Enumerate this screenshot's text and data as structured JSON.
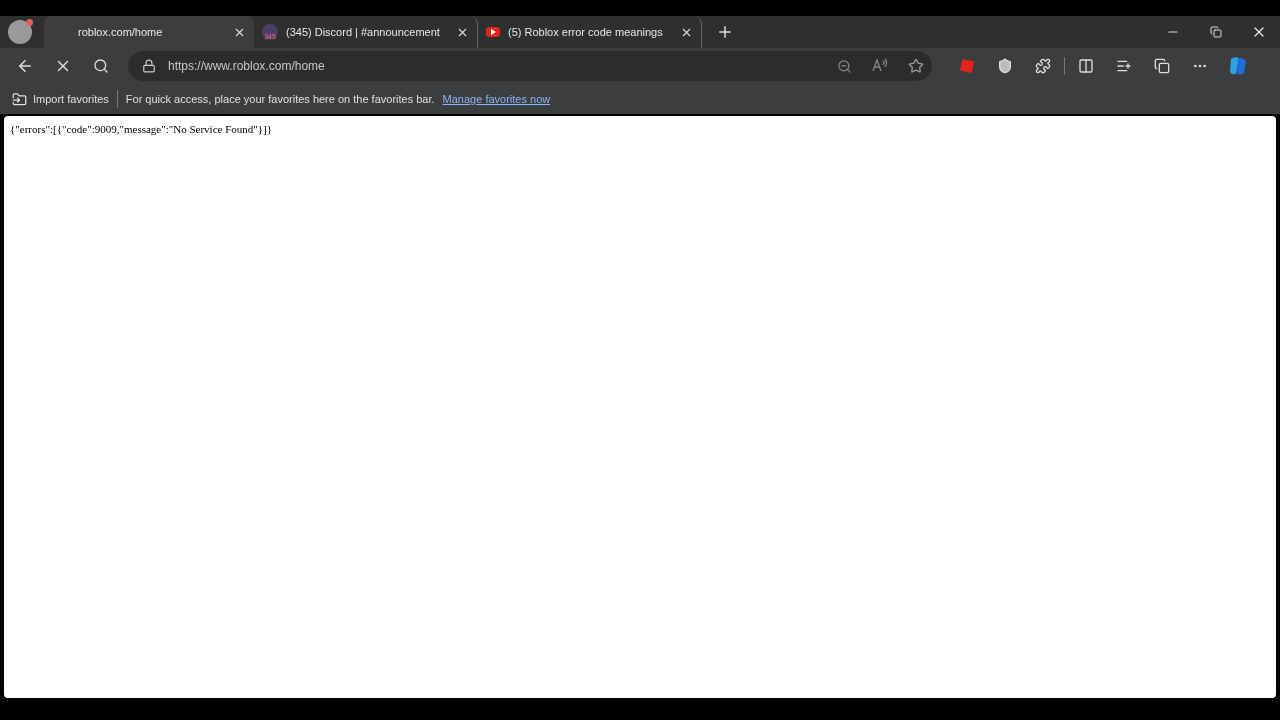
{
  "tabs": [
    {
      "title": "roblox.com/home",
      "kind": "loading",
      "selected": true
    },
    {
      "title": "(345) Discord | #announcement",
      "kind": "discord",
      "badge": "345",
      "selected": false
    },
    {
      "title": "(5) Roblox error code meanings",
      "kind": "youtube",
      "selected": false
    }
  ],
  "address_bar": {
    "url": "https://www.roblox.com/home"
  },
  "favorites_bar": {
    "import_label": "Import favorites",
    "hint": "For quick access, place your favorites here on the favorites bar.",
    "link": "Manage favorites now"
  },
  "page": {
    "body": "{\"errors\":[{\"code\":9009,\"message\":\"No Service Found\"}]}"
  }
}
